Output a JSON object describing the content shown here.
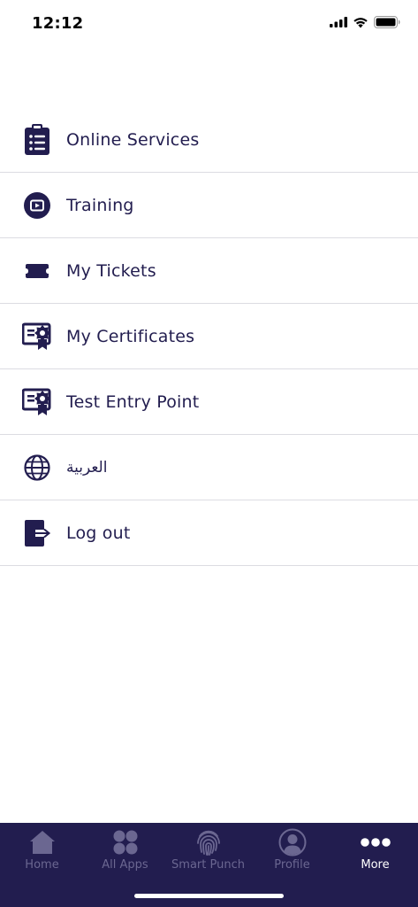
{
  "status_bar": {
    "time": "12:12"
  },
  "menu": {
    "items": [
      {
        "label": "Online Services",
        "icon": "clipboard-list-icon"
      },
      {
        "label": "Training",
        "icon": "play-video-icon"
      },
      {
        "label": "My Tickets",
        "icon": "ticket-icon"
      },
      {
        "label": "My Certificates",
        "icon": "certificate-icon"
      },
      {
        "label": "Test Entry Point",
        "icon": "certificate-icon"
      },
      {
        "label": "العربية",
        "icon": "globe-icon"
      },
      {
        "label": "Log out",
        "icon": "logout-icon"
      }
    ]
  },
  "tab_bar": {
    "tabs": [
      {
        "label": "Home",
        "icon": "home-icon",
        "active": false
      },
      {
        "label": "All Apps",
        "icon": "apps-grid-icon",
        "active": false
      },
      {
        "label": "Smart Punch",
        "icon": "fingerprint-icon",
        "active": false
      },
      {
        "label": "Profile",
        "icon": "profile-icon",
        "active": false
      },
      {
        "label": "More",
        "icon": "more-dots-icon",
        "active": true
      }
    ]
  },
  "colors": {
    "primary": "#221d4f",
    "divider": "#dcdce2",
    "tab_inactive": "#6b6791",
    "tab_active": "#ffffff"
  }
}
